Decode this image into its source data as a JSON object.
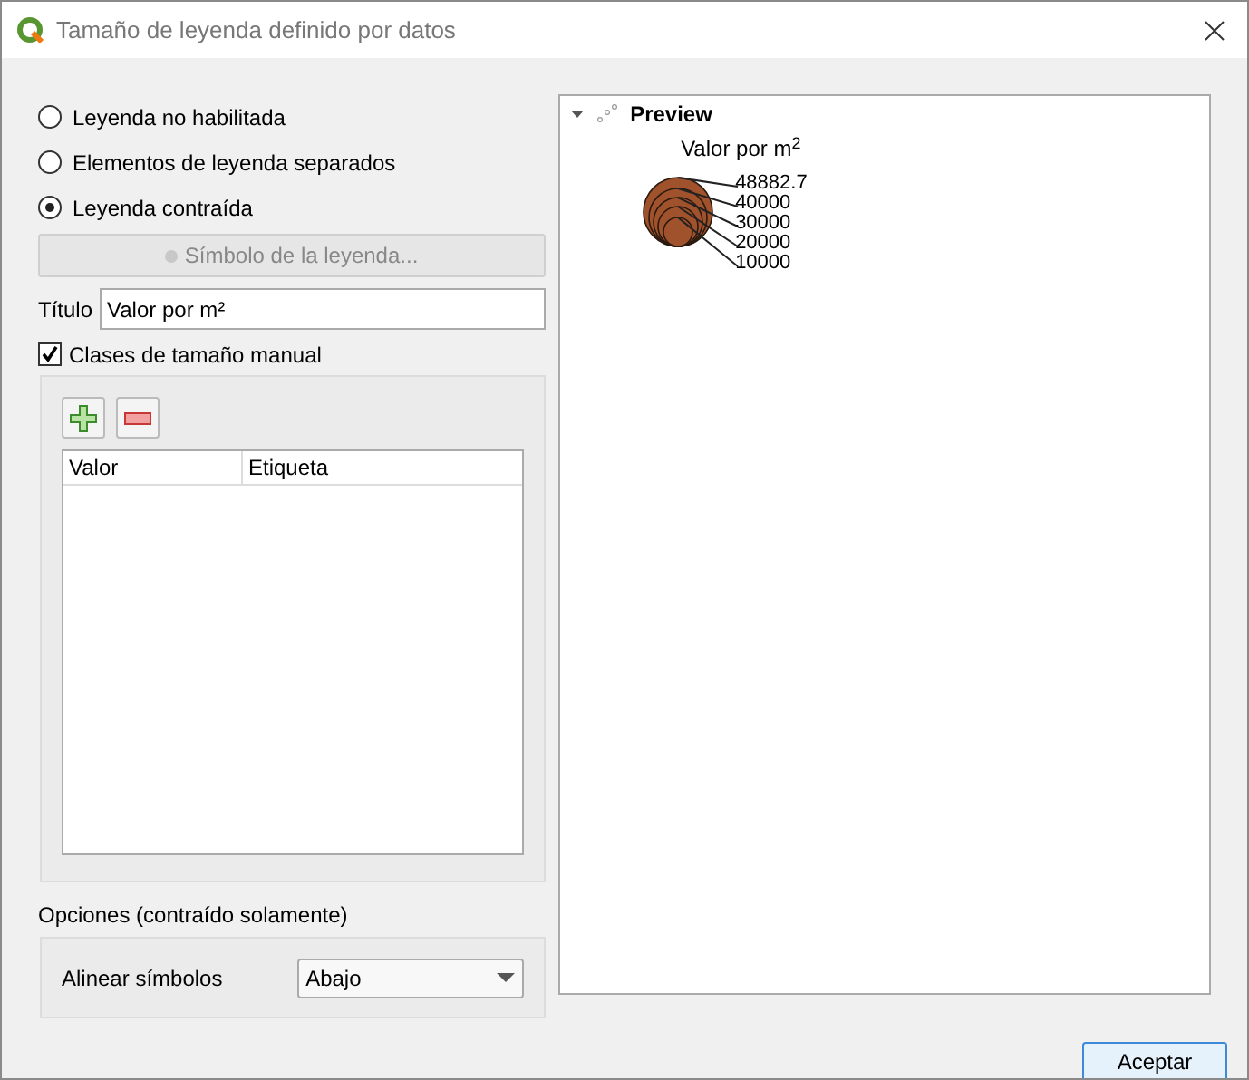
{
  "window": {
    "title": "Tamaño de leyenda definido por datos"
  },
  "legend_modes": [
    {
      "label": "Leyenda no habilitada",
      "selected": false
    },
    {
      "label": "Elementos de leyenda separados",
      "selected": false
    },
    {
      "label": "Leyenda contraída",
      "selected": true
    }
  ],
  "symbol_button": {
    "label": "Símbolo de la leyenda...",
    "disabled": true
  },
  "title_field": {
    "label": "Título",
    "value": "Valor por m²"
  },
  "manual_classes": {
    "label": "Clases de tamaño manual",
    "checked": true
  },
  "classes_table": {
    "columns": [
      "Valor",
      "Etiqueta"
    ]
  },
  "options": {
    "heading": "Opciones (contraído solamente)",
    "align_label": "Alinear símbolos",
    "align_value": "Abajo"
  },
  "preview": {
    "root": "Preview",
    "expanded": true,
    "title": "Valor por m$^{2}$",
    "labels": [
      "48882.7",
      "40000",
      "30000",
      "20000",
      "10000"
    ]
  },
  "buttons": [
    "Aceptar"
  ]
}
